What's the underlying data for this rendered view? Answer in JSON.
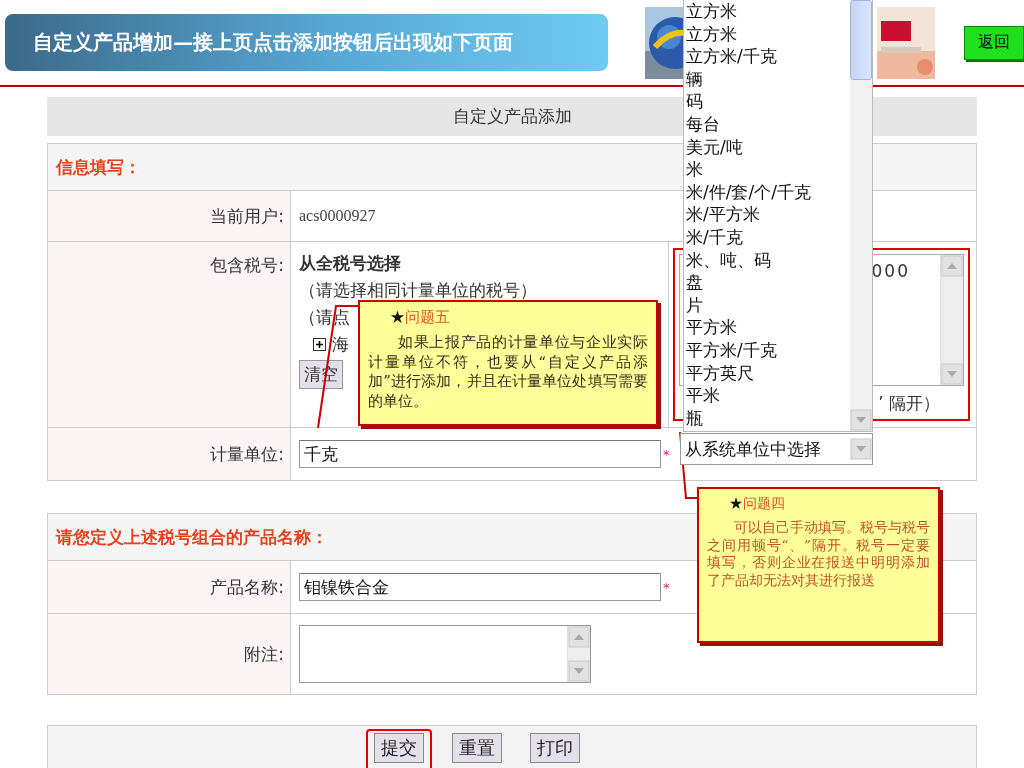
{
  "header": {
    "title": "自定义产品增加—接上页点击添加按钮后出现如下页面",
    "back_button": "返回"
  },
  "form": {
    "title": "自定义产品添加",
    "sections": [
      {
        "heading": "信息填写：",
        "rows": [
          {
            "kind": "text",
            "label": "当前用户:",
            "value": "acs0000927"
          },
          {
            "kind": "tax",
            "label": "包含税号:",
            "heading": "从全税号选择",
            "lines": [
              "（请选择相同计量单位的税号）",
              "（请点"
            ],
            "tree_item": "海",
            "tree_expanded": false,
            "clear_button": "清空",
            "codes_value": "000",
            "codes_hint": "’ 隔开）",
            "highlighted": true
          },
          {
            "kind": "input",
            "label": "计量单位:",
            "value": "千克",
            "required_mark": "*"
          }
        ]
      },
      {
        "heading": "请您定义上述税号组合的产品名称：",
        "rows": [
          {
            "kind": "input",
            "label": "产品名称:",
            "value": "钼镍铁合金",
            "required_mark": "*"
          },
          {
            "kind": "textarea",
            "label": "附注:"
          }
        ]
      }
    ],
    "buttons": [
      {
        "label": "提交",
        "highlighted": true
      },
      {
        "label": "重置",
        "highlighted": false
      },
      {
        "label": "打印",
        "highlighted": false
      }
    ]
  },
  "unit_dropdown": {
    "options": [
      "立方米",
      "立方米",
      "立方米/千克",
      "辆",
      "码",
      "每台",
      "美元/吨",
      "米",
      "米/件/套/个/千克",
      "米/平方米",
      "米/千克",
      "米、吨、码",
      "盘",
      "片",
      "平方米",
      "平方米/千克",
      "平方英尺",
      "平米",
      "瓶"
    ],
    "value": "从系统单位中选择"
  },
  "callouts": [
    {
      "marker": "★",
      "title": "问题五",
      "text": "如果上报产品的计量单位与企业实际计量单位不符，也要从“自定义产品添加”进行添加，并且在计量单位处填写需要的单位。"
    },
    {
      "marker": "★",
      "title": "问题四",
      "text": "可以自己手动填写。税号与税号之间用顿号“、”隔开。税号一定要填写，否则企业在报送中明明添加了产品却无法对其进行报送"
    }
  ]
}
